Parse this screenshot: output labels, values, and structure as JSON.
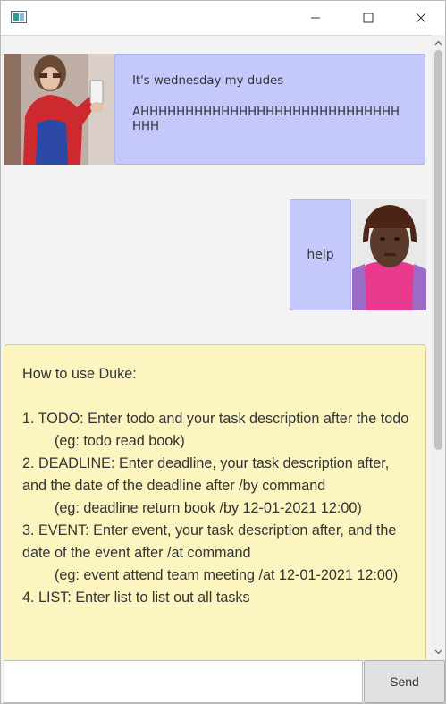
{
  "window": {
    "icon": "java-app-icon",
    "controls": {
      "minimize": "minimize-icon",
      "maximize": "maximize-icon",
      "close": "close-icon"
    }
  },
  "messages": {
    "duke_greeting": {
      "line1": "It's wednesday my dudes",
      "line2": "AHHHHHHHHHHHHHHHHHHHHHHHHHHHHHHHH"
    },
    "user_help": {
      "text": "help"
    },
    "duke_help": {
      "text": "How to use Duke:\n\n1. TODO: Enter todo and your task description after the todo\n        (eg: todo read book)\n2. DEADLINE: Enter deadline, your task description after, and the date of the deadline after /by command\n        (eg: deadline return book /by 12-01-2021 12:00)\n3. EVENT: Enter event, your task description after, and the date of the event after /at command\n        (eg: event attend team meeting /at 12-01-2021 12:00)\n4. LIST: Enter list to list out all tasks"
    }
  },
  "input": {
    "value": "",
    "placeholder": ""
  },
  "send_label": "Send",
  "colors": {
    "bubble": "#c5c8fb",
    "help_bubble": "#fdf5c0",
    "background": "#f3f3f3"
  }
}
